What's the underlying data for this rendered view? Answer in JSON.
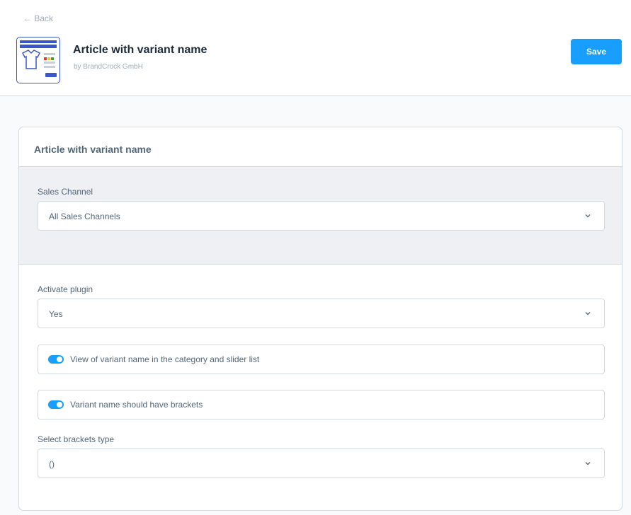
{
  "header": {
    "back_label": "← Back",
    "plugin_name": "Article with variant name",
    "vendor": "by BrandCrock GmbH",
    "save_label": "Save",
    "accent_color": "#189eff"
  },
  "card": {
    "title": "Article with variant name",
    "sales_channel": {
      "label": "Sales Channel",
      "value": "All Sales Channels"
    },
    "activate_plugin": {
      "label": "Activate plugin",
      "value": "Yes"
    },
    "switches": [
      {
        "label": "View of variant name in the category and slider list",
        "checked": true
      },
      {
        "label": "Variant name should have brackets",
        "checked": true
      }
    ],
    "brackets_type": {
      "label": "Select brackets type",
      "value": "()"
    }
  },
  "icons": [
    "back-arrow-icon",
    "plugin-logo-icon",
    "chevron-down-icon",
    "toggle-switch-icon"
  ]
}
